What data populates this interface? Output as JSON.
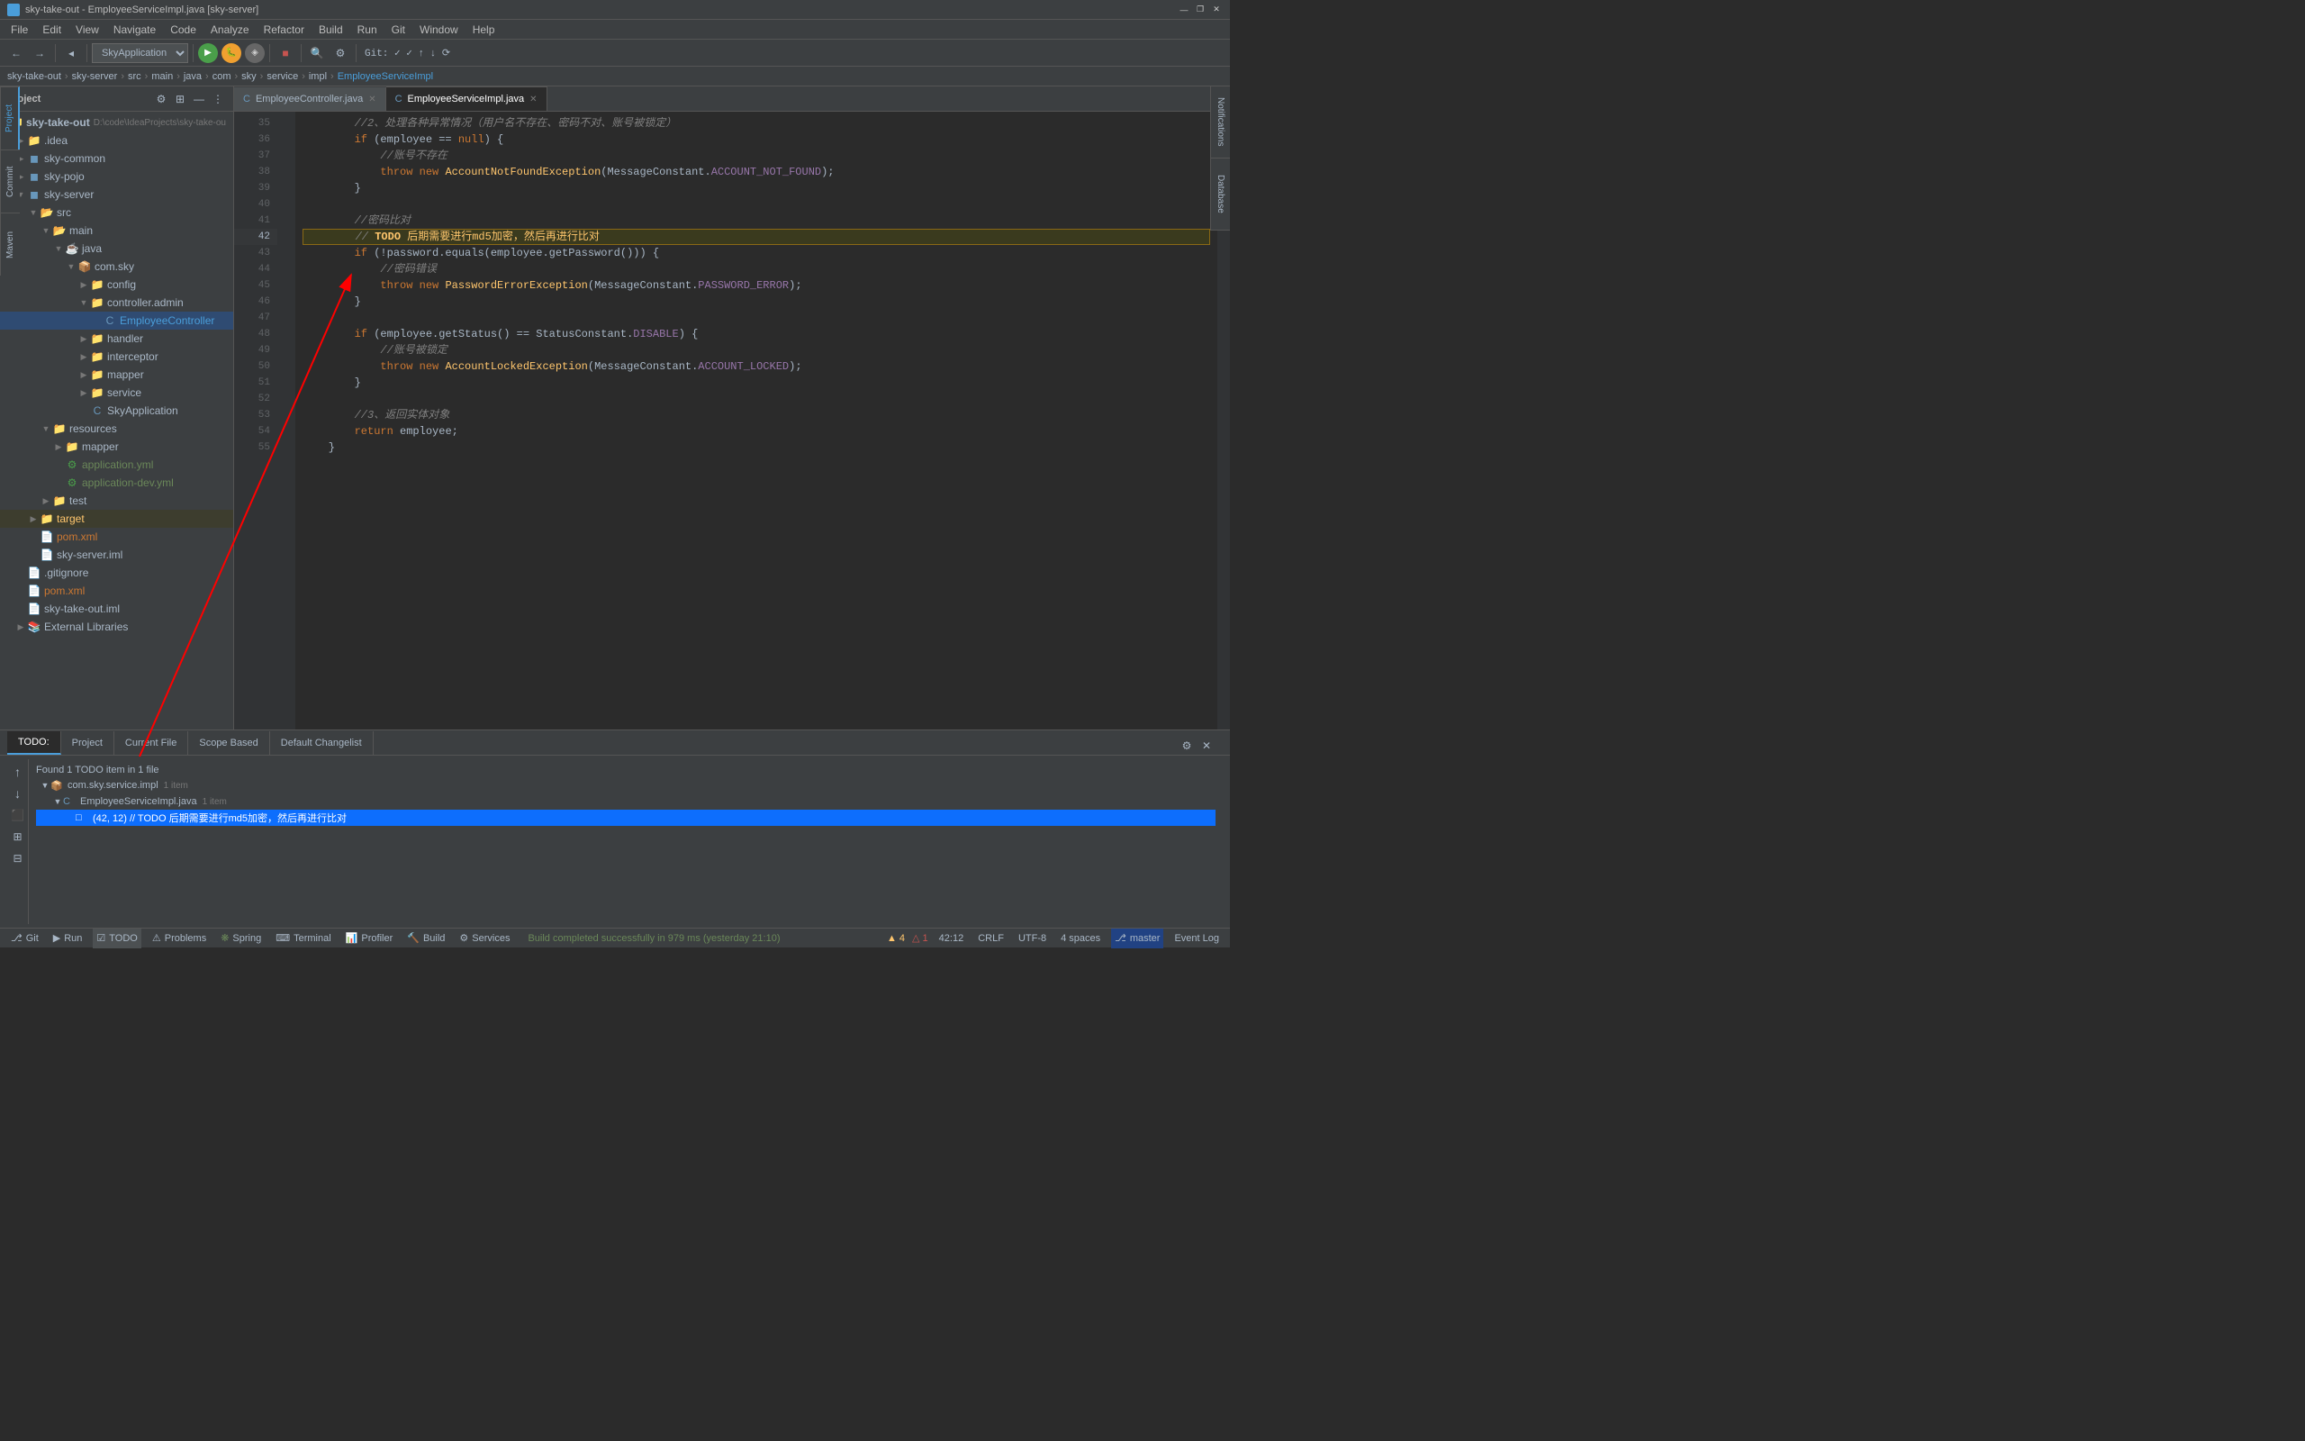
{
  "titleBar": {
    "title": "sky-take-out - EmployeeServiceImpl.java [sky-server]",
    "minBtn": "—",
    "maxBtn": "❐",
    "closeBtn": "✕"
  },
  "menuBar": {
    "items": [
      "File",
      "Edit",
      "View",
      "Navigate",
      "Code",
      "Analyze",
      "Refactor",
      "Build",
      "Run",
      "Git",
      "Window",
      "Help"
    ]
  },
  "toolbar": {
    "appSelect": "SkyApplication",
    "gitStatus": "Git:",
    "branchIcon": "⎇"
  },
  "breadcrumb": {
    "items": [
      "sky-take-out",
      "sky-server",
      "src",
      "main",
      "java",
      "com",
      "sky",
      "service",
      "impl",
      "EmployeeServiceImpl"
    ]
  },
  "sidebar": {
    "title": "Project",
    "root": "sky-take-out",
    "rootPath": "D:\\code\\IdeaProjects\\sky-take-ou",
    "items": [
      {
        "id": "idea",
        "label": ".idea",
        "indent": 1,
        "type": "folder",
        "collapsed": true
      },
      {
        "id": "sky-common",
        "label": "sky-common",
        "indent": 1,
        "type": "module",
        "collapsed": true
      },
      {
        "id": "sky-pojo",
        "label": "sky-pojo",
        "indent": 1,
        "type": "module",
        "collapsed": true
      },
      {
        "id": "sky-server",
        "label": "sky-server",
        "indent": 1,
        "type": "module",
        "collapsed": false
      },
      {
        "id": "src",
        "label": "src",
        "indent": 2,
        "type": "folder",
        "collapsed": false
      },
      {
        "id": "main",
        "label": "main",
        "indent": 3,
        "type": "folder",
        "collapsed": false
      },
      {
        "id": "java",
        "label": "java",
        "indent": 4,
        "type": "folder",
        "collapsed": false
      },
      {
        "id": "com.sky",
        "label": "com.sky",
        "indent": 5,
        "type": "package",
        "collapsed": false
      },
      {
        "id": "config",
        "label": "config",
        "indent": 6,
        "type": "folder",
        "collapsed": true
      },
      {
        "id": "controller.admin",
        "label": "controller.admin",
        "indent": 6,
        "type": "folder",
        "collapsed": false
      },
      {
        "id": "EmployeeController",
        "label": "EmployeeController",
        "indent": 7,
        "type": "class",
        "collapsed": false
      },
      {
        "id": "handler",
        "label": "handler",
        "indent": 6,
        "type": "folder",
        "collapsed": true
      },
      {
        "id": "interceptor",
        "label": "interceptor",
        "indent": 6,
        "type": "folder",
        "collapsed": true
      },
      {
        "id": "mapper",
        "label": "mapper",
        "indent": 6,
        "type": "folder",
        "collapsed": true
      },
      {
        "id": "service",
        "label": "service",
        "indent": 6,
        "type": "folder",
        "collapsed": true
      },
      {
        "id": "SkyApplication",
        "label": "SkyApplication",
        "indent": 6,
        "type": "class",
        "collapsed": false
      },
      {
        "id": "resources",
        "label": "resources",
        "indent": 3,
        "type": "folder",
        "collapsed": false
      },
      {
        "id": "mapper2",
        "label": "mapper",
        "indent": 4,
        "type": "folder",
        "collapsed": true
      },
      {
        "id": "application.yml",
        "label": "application.yml",
        "indent": 4,
        "type": "yml"
      },
      {
        "id": "application-dev.yml",
        "label": "application-dev.yml",
        "indent": 4,
        "type": "yml"
      },
      {
        "id": "test",
        "label": "test",
        "indent": 3,
        "type": "folder",
        "collapsed": true
      },
      {
        "id": "target",
        "label": "target",
        "indent": 2,
        "type": "folder",
        "collapsed": true,
        "highlighted": true
      },
      {
        "id": "pom.xml2",
        "label": "pom.xml",
        "indent": 2,
        "type": "xml"
      },
      {
        "id": "sky-server.iml",
        "label": "sky-server.iml",
        "indent": 2,
        "type": "iml"
      },
      {
        "id": "gitignore",
        "label": ".gitignore",
        "indent": 1,
        "type": "file"
      },
      {
        "id": "pom.xml",
        "label": "pom.xml",
        "indent": 1,
        "type": "xml"
      },
      {
        "id": "sky-take-out.iml",
        "label": "sky-take-out.iml",
        "indent": 1,
        "type": "iml"
      },
      {
        "id": "ExternalLibraries",
        "label": "External Libraries",
        "indent": 1,
        "type": "folder",
        "collapsed": true
      }
    ]
  },
  "leftTabs": [
    "Project",
    "Commit",
    "Maven"
  ],
  "rightTabs": [
    "Notifications",
    "Database"
  ],
  "editorTabs": [
    {
      "label": "EmployeeController.java",
      "active": false,
      "modified": false
    },
    {
      "label": "EmployeeServiceImpl.java",
      "active": true,
      "modified": false
    }
  ],
  "codeLines": [
    {
      "num": 35,
      "content": "        //2、处理各种异常情况（用户名不存在、密码不对、账号被锁定）",
      "type": "comment"
    },
    {
      "num": 36,
      "content": "        if (employee == null) {",
      "type": "code"
    },
    {
      "num": 37,
      "content": "            //账号不存在",
      "type": "comment"
    },
    {
      "num": 38,
      "content": "            throw new AccountNotFoundException(MessageConstant.ACCOUNT_NOT_FOUND);",
      "type": "throw1"
    },
    {
      "num": 39,
      "content": "        }",
      "type": "code"
    },
    {
      "num": 40,
      "content": "",
      "type": "empty"
    },
    {
      "num": 41,
      "content": "        //密码比对",
      "type": "comment"
    },
    {
      "num": 42,
      "content": "        // TODO 后期需要进行md5加密，然后再进行比对",
      "type": "todo"
    },
    {
      "num": 43,
      "content": "        if (!password.equals(employee.getPassword())) {",
      "type": "code"
    },
    {
      "num": 44,
      "content": "            //密码错误",
      "type": "comment"
    },
    {
      "num": 45,
      "content": "            throw new PasswordErrorException(MessageConstant.PASSWORD_ERROR);",
      "type": "throw2"
    },
    {
      "num": 46,
      "content": "        }",
      "type": "code"
    },
    {
      "num": 47,
      "content": "",
      "type": "empty"
    },
    {
      "num": 48,
      "content": "        if (employee.getStatus() == StatusConstant.DISABLE) {",
      "type": "code"
    },
    {
      "num": 49,
      "content": "            //账号被锁定",
      "type": "comment"
    },
    {
      "num": 50,
      "content": "            throw new AccountLockedException(MessageConstant.ACCOUNT_LOCKED);",
      "type": "throw3"
    },
    {
      "num": 51,
      "content": "        }",
      "type": "code"
    },
    {
      "num": 52,
      "content": "",
      "type": "empty"
    },
    {
      "num": 53,
      "content": "        //3、返回实体对象",
      "type": "comment"
    },
    {
      "num": 54,
      "content": "        return employee;",
      "type": "code"
    },
    {
      "num": 55,
      "content": "    }",
      "type": "code"
    }
  ],
  "bottomTabs": {
    "tabs": [
      "TODO",
      "Project",
      "Current File",
      "Scope Based",
      "Default Changelist"
    ],
    "activeTab": "TODO"
  },
  "todoPanel": {
    "headerText": "Found 1 TODO item in 1 file",
    "groups": [
      {
        "label": "com.sky.service.impl",
        "badge": "1 item",
        "items": [
          {
            "label": "EmployeeServiceImpl.java",
            "badge": "1 item",
            "items": [
              {
                "label": "(42, 12) // TODO 后期需要进行md5加密，然后再进行比对",
                "selected": true
              }
            ]
          }
        ]
      }
    ]
  },
  "statusBar": {
    "buildStatus": "Build completed successfully in 979 ms (yesterday 21:10)",
    "position": "42:12",
    "lineEnding": "CRLF",
    "encoding": "UTF-8",
    "indent": "4 spaces",
    "branch": "master",
    "tabs": [
      "Git",
      "Run",
      "TODO",
      "Problems",
      "Spring",
      "Terminal",
      "Profiler",
      "Build",
      "Services"
    ],
    "activeTab": "TODO",
    "eventLog": "Event Log",
    "warningCount": "4",
    "errorCount": "1"
  }
}
